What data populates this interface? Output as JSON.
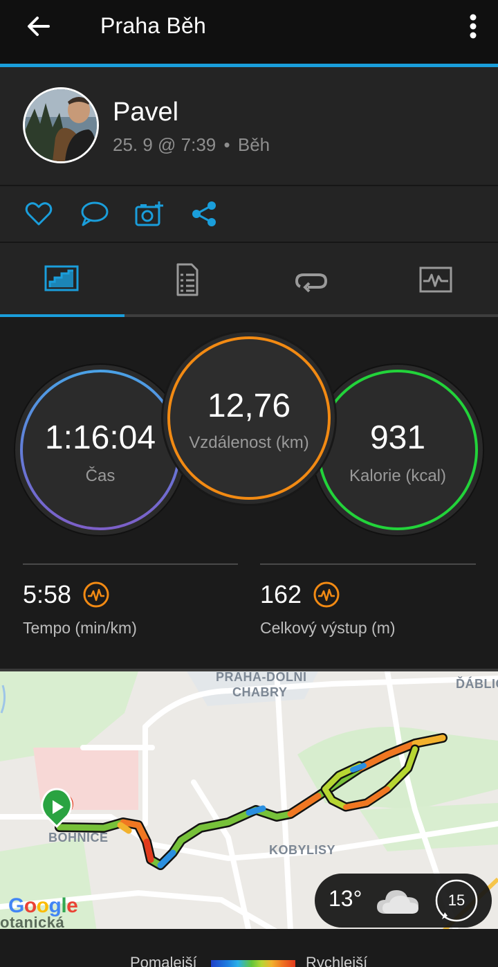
{
  "header": {
    "title": "Praha Běh",
    "back_icon": "arrow-left-icon",
    "menu_icon": "more-vertical-icon",
    "accent_color": "#1a9edb"
  },
  "profile": {
    "name": "Pavel",
    "date": "25. 9 @ 7:39",
    "separator": "•",
    "activity": "Běh"
  },
  "actions": [
    {
      "icon": "heart-icon"
    },
    {
      "icon": "comment-icon"
    },
    {
      "icon": "add-photo-icon"
    },
    {
      "icon": "share-icon"
    }
  ],
  "tabs": [
    {
      "icon": "overview-tab-icon",
      "active": true
    },
    {
      "icon": "details-tab-icon",
      "active": false
    },
    {
      "icon": "laps-tab-icon",
      "active": false
    },
    {
      "icon": "charts-tab-icon",
      "active": false
    }
  ],
  "stats": {
    "time": {
      "value": "1:16:04",
      "label": "Čas"
    },
    "distance": {
      "value": "12,76",
      "label": "Vzdálenost (km)"
    },
    "calories": {
      "value": "931",
      "label": "Kalorie (kcal)"
    },
    "pace": {
      "value": "5:58",
      "label": "Tempo (min/km)"
    },
    "ascent": {
      "value": "162",
      "label": "Celkový výstup (m)"
    }
  },
  "map": {
    "labels": {
      "praha_dolni": "PRAHA-DOLNÍ",
      "chabry": "CHABRY",
      "dablice": "ĎÁBLIC",
      "bohnice": "BOHNICE",
      "kobylisy": "KOBYLISY",
      "botanicka": "otanická"
    },
    "weather": {
      "temperature": "13°",
      "condition_icon": "cloudy-icon",
      "wind": "15"
    },
    "logo": "Google"
  },
  "legend": {
    "slower": "Pomalejší",
    "faster": "Rychlejší"
  }
}
